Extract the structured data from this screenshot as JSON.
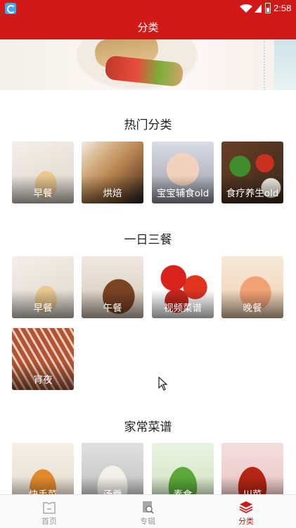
{
  "status_bar": {
    "time": "2:58"
  },
  "header": {
    "title": "分类"
  },
  "sections": [
    {
      "title": "热门分类",
      "items": [
        {
          "label": "早餐"
        },
        {
          "label": "烘焙"
        },
        {
          "label": "宝宝辅食old"
        },
        {
          "label": "食疗养生old"
        }
      ]
    },
    {
      "title": "一日三餐",
      "items": [
        {
          "label": "早餐"
        },
        {
          "label": "午餐"
        },
        {
          "label": "视频菜谱"
        },
        {
          "label": "晚餐"
        },
        {
          "label": "宵夜"
        }
      ]
    },
    {
      "title": "家常菜谱",
      "items": [
        {
          "label": "快手菜"
        },
        {
          "label": "汤羹"
        },
        {
          "label": "素食"
        },
        {
          "label": "川菜"
        }
      ]
    }
  ],
  "bottom_nav": {
    "items": [
      {
        "label": "首页",
        "icon": "home-icon",
        "active": false
      },
      {
        "label": "专辑",
        "icon": "album-icon",
        "active": false
      },
      {
        "label": "分类",
        "icon": "category-layers-icon",
        "active": true
      }
    ]
  },
  "colors": {
    "brand_red": "#d11a18",
    "inactive_gray": "#9a9a9a"
  }
}
